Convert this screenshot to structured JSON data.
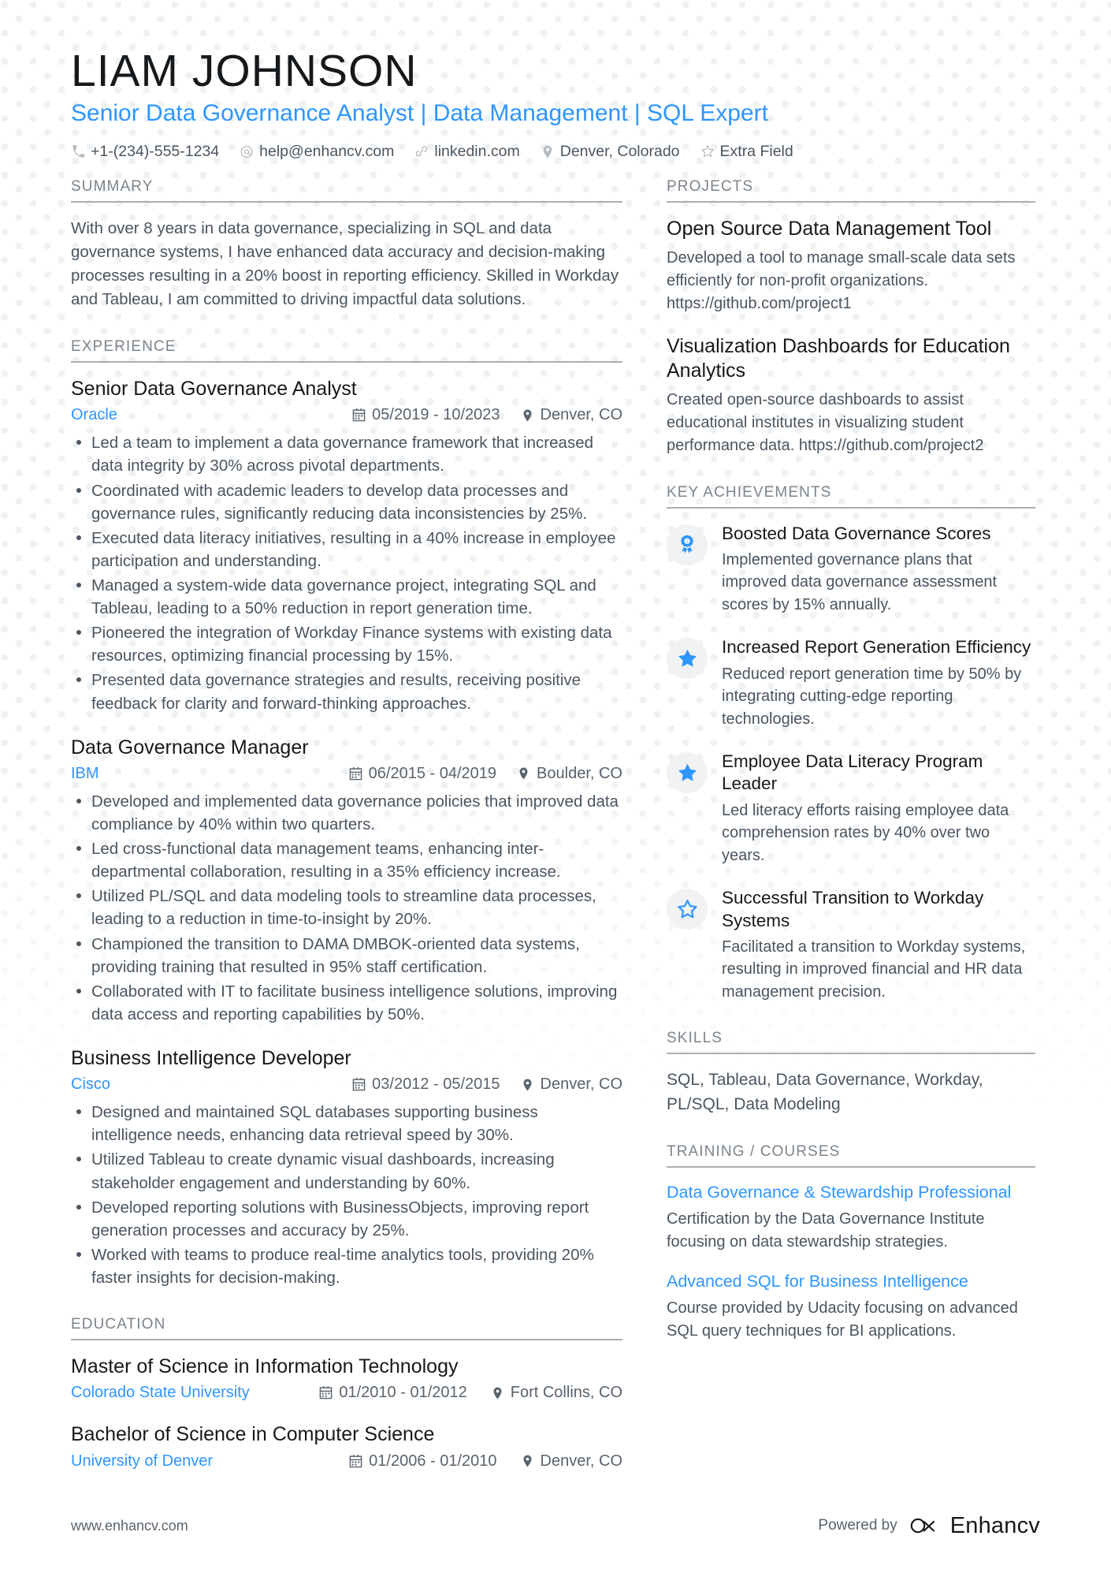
{
  "header": {
    "name": "LIAM JOHNSON",
    "headline": "Senior Data Governance Analyst | Data Management | SQL Expert",
    "contacts": [
      {
        "icon": "phone-icon",
        "text": "+1-(234)-555-1234"
      },
      {
        "icon": "email-icon",
        "text": "help@enhancv.com"
      },
      {
        "icon": "link-icon",
        "text": "linkedin.com"
      },
      {
        "icon": "location-icon",
        "text": "Denver, Colorado"
      },
      {
        "icon": "star-outline-icon",
        "text": "Extra Field"
      }
    ]
  },
  "left": {
    "summary": {
      "section_title": "SUMMARY",
      "text": "With over 8 years in data governance, specializing in SQL and data governance systems, I have enhanced data accuracy and decision-making processes resulting in a 20% boost in reporting efficiency. Skilled in Workday and Tableau, I am committed to driving impactful data solutions."
    },
    "experience": {
      "section_title": "EXPERIENCE",
      "entries": [
        {
          "title": "Senior Data Governance Analyst",
          "org": "Oracle",
          "dates": "05/2019 - 10/2023",
          "location": "Denver, CO",
          "bullets": [
            "Led a team to implement a data governance framework that increased data integrity by 30% across pivotal departments.",
            "Coordinated with academic leaders to develop data processes and governance rules, significantly reducing data inconsistencies by 25%.",
            "Executed data literacy initiatives, resulting in a 40% increase in employee participation and understanding.",
            "Managed a system-wide data governance project, integrating SQL and Tableau, leading to a 50% reduction in report generation time.",
            "Pioneered the integration of Workday Finance systems with existing data resources, optimizing financial processing by 15%.",
            "Presented data governance strategies and results, receiving positive feedback for clarity and forward-thinking approaches."
          ]
        },
        {
          "title": "Data Governance Manager",
          "org": "IBM",
          "dates": "06/2015 - 04/2019",
          "location": "Boulder, CO",
          "bullets": [
            "Developed and implemented data governance policies that improved data compliance by 40% within two quarters.",
            "Led cross-functional data management teams, enhancing inter-departmental collaboration, resulting in a 35% efficiency increase.",
            "Utilized PL/SQL and data modeling tools to streamline data processes, leading to a reduction in time-to-insight by 20%.",
            "Championed the transition to DAMA DMBOK-oriented data systems, providing training that resulted in 95% staff certification.",
            "Collaborated with IT to facilitate business intelligence solutions, improving data access and reporting capabilities by 50%."
          ]
        },
        {
          "title": "Business Intelligence Developer",
          "org": "Cisco",
          "dates": "03/2012 - 05/2015",
          "location": "Denver, CO",
          "bullets": [
            "Designed and maintained SQL databases supporting business intelligence needs, enhancing data retrieval speed by 30%.",
            "Utilized Tableau to create dynamic visual dashboards, increasing stakeholder engagement and understanding by 60%.",
            "Developed reporting solutions with BusinessObjects, improving report generation processes and accuracy by 25%.",
            "Worked with teams to produce real-time analytics tools, providing 20% faster insights for decision-making."
          ]
        }
      ]
    },
    "education": {
      "section_title": "EDUCATION",
      "entries": [
        {
          "title": "Master of Science in Information Technology",
          "org": "Colorado State University",
          "dates": "01/2010 - 01/2012",
          "location": "Fort Collins, CO"
        },
        {
          "title": "Bachelor of Science in Computer Science",
          "org": "University of Denver",
          "dates": "01/2006 - 01/2010",
          "location": "Denver, CO"
        }
      ]
    }
  },
  "right": {
    "projects": {
      "section_title": "PROJECTS",
      "entries": [
        {
          "title": "Open Source Data Management Tool",
          "desc": "Developed a tool to manage small-scale data sets efficiently for non-profit organizations. https://github.com/project1"
        },
        {
          "title": "Visualization Dashboards for Education Analytics",
          "desc": "Created open-source dashboards to assist educational institutes in visualizing student performance data. https://github.com/project2"
        }
      ]
    },
    "achievements": {
      "section_title": "KEY ACHIEVEMENTS",
      "entries": [
        {
          "icon": "award-badge-icon",
          "title": "Boosted Data Governance Scores",
          "desc": "Implemented governance plans that improved data governance assessment scores by 15% annually."
        },
        {
          "icon": "star-filled-icon",
          "title": "Increased Report Generation Efficiency",
          "desc": "Reduced report generation time by 50% by integrating cutting-edge reporting technologies."
        },
        {
          "icon": "star-filled-icon",
          "title": "Employee Data Literacy Program Leader",
          "desc": "Led literacy efforts raising employee data comprehension rates by 40% over two years."
        },
        {
          "icon": "star-outline-icon",
          "title": "Successful Transition to Workday Systems",
          "desc": "Facilitated a transition to Workday systems, resulting in improved financial and HR data management precision."
        }
      ]
    },
    "skills": {
      "section_title": "SKILLS",
      "text": "SQL, Tableau, Data Governance, Workday, PL/SQL, Data Modeling"
    },
    "training": {
      "section_title": "TRAINING / COURSES",
      "entries": [
        {
          "title": "Data Governance & Stewardship Professional",
          "desc": "Certification by the Data Governance Institute focusing on data stewardship strategies."
        },
        {
          "title": "Advanced SQL for Business Intelligence",
          "desc": "Course provided by Udacity focusing on advanced SQL query techniques for BI applications."
        }
      ]
    }
  },
  "footer": {
    "url": "www.enhancv.com",
    "powered_by": "Powered by",
    "brand": "Enhancv"
  },
  "colors": {
    "accent": "#2D96FF",
    "heading": "#16191c",
    "body": "#4a5560",
    "muted": "#7c848c",
    "rule": "#a9afb5",
    "badge_bg": "#f1f2f3"
  }
}
